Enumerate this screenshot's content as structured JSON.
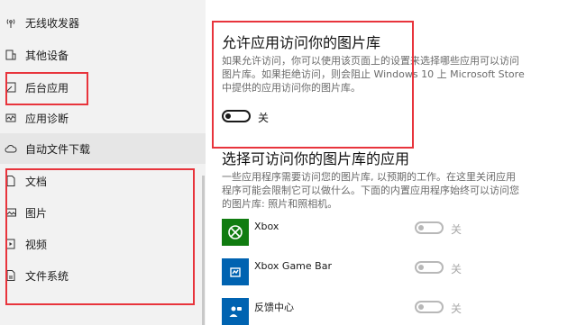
{
  "sidebar": {
    "items": [
      {
        "label": "无线收发器",
        "icon": "radio-tower-icon"
      },
      {
        "label": "其他设备",
        "icon": "devices-icon"
      },
      {
        "label": "后台应用",
        "icon": "background-apps-icon"
      },
      {
        "label": "应用诊断",
        "icon": "diagnostics-icon"
      },
      {
        "label": "自动文件下载",
        "icon": "cloud-icon"
      },
      {
        "label": "文档",
        "icon": "document-icon"
      },
      {
        "label": "图片",
        "icon": "picture-icon"
      },
      {
        "label": "视频",
        "icon": "video-icon"
      },
      {
        "label": "文件系统",
        "icon": "file-system-icon"
      }
    ]
  },
  "main": {
    "access_title": "允许应用访问你的图片库",
    "access_desc": "如果允许访问，你可以使用该页面上的设置来选择哪些应用可以访问图片库。如果拒绝访问，则会阻止 Windows 10 上 Microsoft Store 中提供的应用访问你的图片库。",
    "access_toggle_label": "关",
    "choose_title": "选择可访问你的图片库的应用",
    "choose_desc": "一些应用程序需要访问您的图片库, 以预期的工作。在这里关闭应用程序可能会限制它可以做什么。下面的内置应用程序始终可以访问您的图片库: 照片和照相机。",
    "apps": [
      {
        "name": "Xbox",
        "toggle_label": "关",
        "tile_color": "#107c10",
        "icon": "xbox-icon"
      },
      {
        "name": "Xbox Game Bar",
        "toggle_label": "关",
        "tile_color": "#0063b1",
        "icon": "game-bar-icon"
      },
      {
        "name": "反馈中心",
        "toggle_label": "关",
        "tile_color": "#0063b1",
        "icon": "feedback-hub-icon"
      }
    ]
  },
  "colors": {
    "annotation": "#e8343c",
    "sidebar_bg": "#f2f2f2",
    "selected_bg": "#e6e6e6"
  }
}
